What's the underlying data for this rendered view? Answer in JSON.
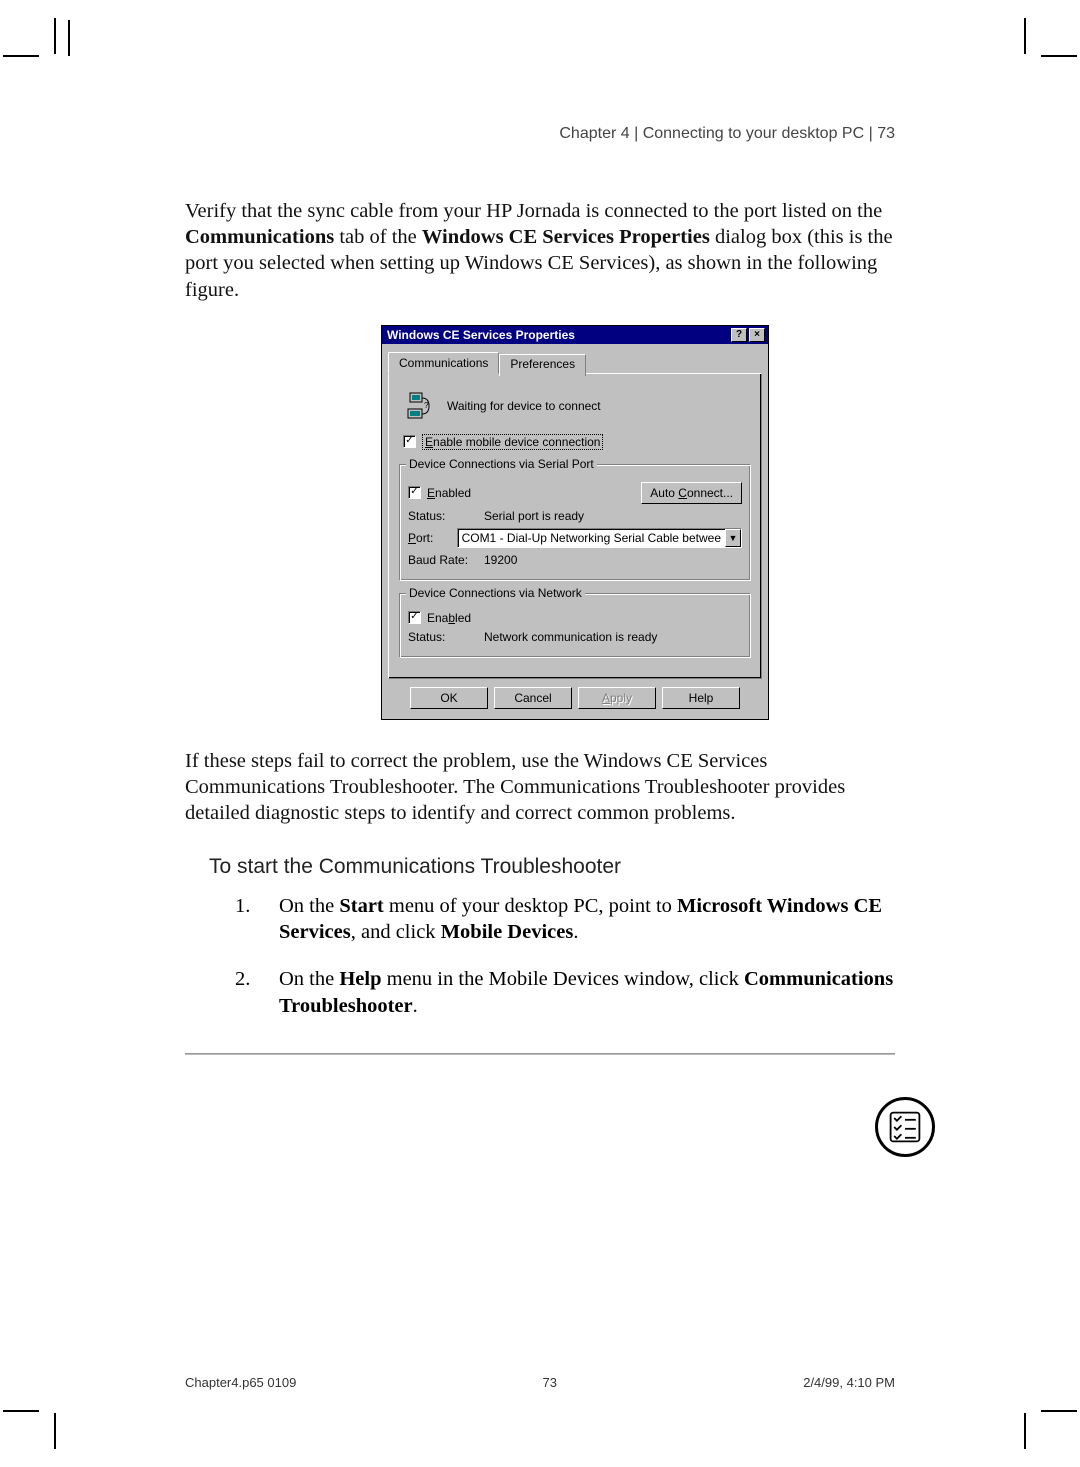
{
  "header": "Chapter 4 | Connecting to your desktop PC | 73",
  "para1_pre": "Verify that the sync cable from your HP Jornada is connected to the port listed on the ",
  "para1_b1": "Communications",
  "para1_mid": " tab of the ",
  "para1_b2": "Windows CE Services Properties",
  "para1_post": " dialog box (this is the port you selected when setting up Windows CE Services), as shown in the following figure.",
  "dialog": {
    "title": "Windows CE Services Properties",
    "help_btn": "?",
    "close_btn": "×",
    "tabs": {
      "active": "Communications",
      "inactive": "Preferences"
    },
    "waiting": "Waiting for device to connect",
    "enable_conn_pre": "E",
    "enable_conn_post": "nable mobile device connection",
    "serial_group": "Device Connections via Serial Port",
    "enabled_pre": "E",
    "enabled_post": "nabled",
    "auto_connect_pre": "Auto ",
    "auto_connect_u": "C",
    "auto_connect_post": "onnect...",
    "status_lbl": "Status:",
    "status_val": "Serial port is ready",
    "port_lbl_u": "P",
    "port_lbl_post": "ort:",
    "port_val": "COM1 - Dial-Up Networking Serial Cable betwee",
    "baud_lbl": "Baud Rate:",
    "baud_val": "19200",
    "net_group": "Device Connections via Network",
    "net_enabled_pre": "Ena",
    "net_enabled_u": "b",
    "net_enabled_post": "led",
    "net_status_lbl": "Status:",
    "net_status_val": "Network communication is ready",
    "ok": "OK",
    "cancel": "Cancel",
    "apply_u": "A",
    "apply_post": "pply",
    "help": "Help"
  },
  "para2": "If these steps fail to correct the problem, use the Windows CE Services Communications Troubleshooter. The Communications Troubleshooter provides detailed diagnostic steps to identify and correct common problems.",
  "subhead": "To start the Communications Troubleshooter",
  "step1_num": "1.",
  "step1_pre": "On the ",
  "step1_b1": "Start",
  "step1_mid1": " menu of your desktop PC, point to ",
  "step1_b2": "Microsoft Windows CE Services",
  "step1_mid2": ", and click ",
  "step1_b3": "Mobile Devices",
  "step1_post": ".",
  "step2_num": "2.",
  "step2_pre": "On the ",
  "step2_b1": "Help",
  "step2_mid": " menu in the Mobile Devices window, click ",
  "step2_b2": "Communications Troubleshooter",
  "step2_post": ".",
  "footer": {
    "left": "Chapter4.p65 0109",
    "center": "73",
    "right": "2/4/99, 4:10 PM"
  }
}
